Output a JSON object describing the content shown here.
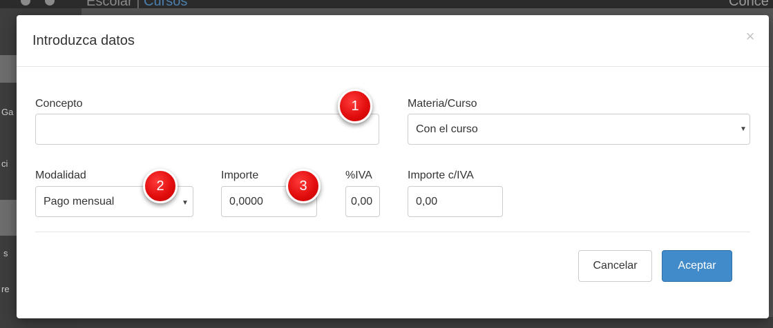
{
  "background": {
    "app_title": "Escolar",
    "app_title_separator": "|",
    "app_section": "Cursos",
    "right_text": "Conce",
    "sidebar_fragments": [
      "Ga",
      "ci",
      "s",
      "re"
    ]
  },
  "modal": {
    "title": "Introduzca datos",
    "close_label": "×",
    "fields": {
      "concepto": {
        "label": "Concepto",
        "value": ""
      },
      "materia": {
        "label": "Materia/Curso",
        "value": "Con el curso"
      },
      "modalidad": {
        "label": "Modalidad",
        "value": "Pago mensual"
      },
      "importe": {
        "label": "Importe",
        "value": "0,0000"
      },
      "iva": {
        "label": "%IVA",
        "value": "0,00"
      },
      "importe_iva": {
        "label": "Importe c/IVA",
        "value": "0,00"
      }
    },
    "badges": [
      "1",
      "2",
      "3"
    ],
    "buttons": {
      "cancel": "Cancelar",
      "accept": "Aceptar"
    }
  },
  "colors": {
    "accent": "#428bca",
    "badge": "#e20e0e",
    "section_link": "#4a7fb0"
  }
}
